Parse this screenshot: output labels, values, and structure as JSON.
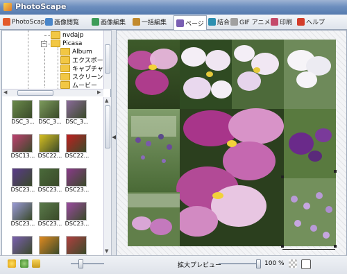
{
  "app": {
    "title": "PhotoScape"
  },
  "tabs": [
    {
      "label": "PhotoScape",
      "color": "#e35a2a"
    },
    {
      "label": "画像閲覧",
      "color": "#4a86c9"
    },
    {
      "label": "画像編集",
      "color": "#3c9b58"
    },
    {
      "label": "一括編集",
      "color": "#c28a2d"
    },
    {
      "label": "ページ",
      "color": "#7a5fb3"
    },
    {
      "label": "結合",
      "color": "#2d8fb0"
    },
    {
      "label": "GIF アニメ",
      "color": "#a0a0a0"
    },
    {
      "label": "印刷",
      "color": "#c44a6a"
    },
    {
      "label": "ヘルプ",
      "color": "#d33d2b"
    }
  ],
  "tree": {
    "nodes": [
      {
        "label": "nvdajp"
      },
      {
        "label": "Picasa"
      },
      {
        "label": "Album"
      },
      {
        "label": "エクスポート済"
      },
      {
        "label": "キャプチャ済み"
      },
      {
        "label": "スクリーン キャ"
      },
      {
        "label": "ムービー"
      }
    ]
  },
  "thumbnails": [
    {
      "caption": "DSC_3...",
      "color": "#6b8a4a"
    },
    {
      "caption": "DSC_3...",
      "color": "#7c9a5c"
    },
    {
      "caption": "DSC_3...",
      "color": "#8a6a9a"
    },
    {
      "caption": "DSC13...",
      "color": "#c04070"
    },
    {
      "caption": "DSC22...",
      "color": "#d8c020"
    },
    {
      "caption": "DSC22...",
      "color": "#c02020"
    },
    {
      "caption": "DSC23...",
      "color": "#5a3a8a"
    },
    {
      "caption": "DSC23...",
      "color": "#4a6a3a"
    },
    {
      "caption": "DSC23...",
      "color": "#8a3a8a"
    },
    {
      "caption": "DSC23...",
      "color": "#9a9ad8"
    },
    {
      "caption": "DSC23...",
      "color": "#5a7a4a"
    },
    {
      "caption": "DSC23...",
      "color": "#9a4aa0"
    },
    {
      "caption": "",
      "color": "#7a60b0"
    },
    {
      "caption": "",
      "color": "#e08a20"
    },
    {
      "caption": "",
      "color": "#b04040"
    }
  ],
  "bottom": {
    "zoom_label": "拡大プレビュー",
    "zoom_value": "100 %"
  },
  "icons": {
    "star": "star-icon",
    "refresh": "rotate-icon",
    "folder": "folder-open-icon"
  }
}
